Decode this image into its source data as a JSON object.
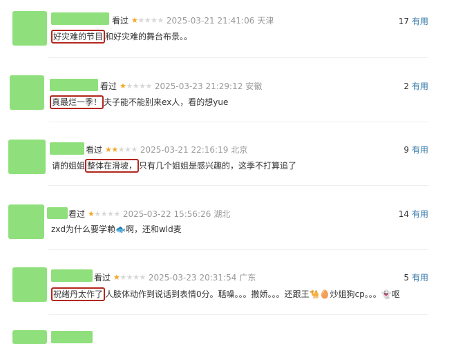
{
  "reviews": [
    {
      "watched": "看过",
      "stars": [
        "on",
        "off",
        "off",
        "off",
        "off"
      ],
      "datetime": "2025-03-21 21:41:06",
      "location": "天津",
      "votes": "17",
      "useful": "有用",
      "highlight": "好灾难的节目",
      "text": "和好灾难的舞台布景。。"
    },
    {
      "watched": "看过",
      "stars": [
        "on",
        "off",
        "off",
        "off",
        "off"
      ],
      "datetime": "2025-03-23 21:29:12",
      "location": "安徽",
      "votes": "2",
      "useful": "有用",
      "highlight": "真最烂一季！",
      "text": "夫子能不能别来ex人，看的想yue"
    },
    {
      "watched": "看过",
      "stars": [
        "on",
        "on",
        "off",
        "off",
        "off"
      ],
      "datetime": "2025-03-21 22:16:19",
      "location": "北京",
      "votes": "9",
      "useful": "有用",
      "prefix": "请的姐姐",
      "highlight": "整体在滑坡，",
      "text": "只有几个姐姐是感兴趣的，这季不打算追了"
    },
    {
      "watched": "看过",
      "stars": [
        "on",
        "off",
        "off",
        "off",
        "off"
      ],
      "datetime": "2025-03-22 15:56:26",
      "location": "湖北",
      "votes": "14",
      "useful": "有用",
      "text_a": "zxd为什么要学赖",
      "text_b": "啊，还和wld麦"
    },
    {
      "watched": "看过",
      "stars": [
        "on",
        "off",
        "off",
        "off",
        "off"
      ],
      "datetime": "2025-03-23 20:31:54",
      "location": "广东",
      "votes": "5",
      "useful": "有用",
      "highlight": "祝绪丹太作了",
      "text_a": "人肢体动作到说话到表情0分。聒噪。。。撒娇。。。还跟王",
      "text_b": "炒姐狗cp。。。",
      "text_c": "呕"
    }
  ]
}
